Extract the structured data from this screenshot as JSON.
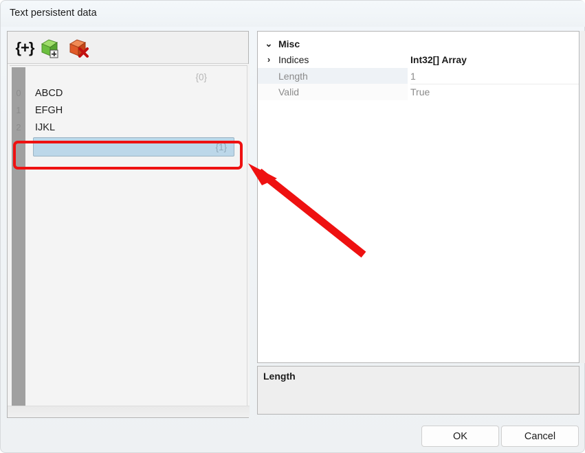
{
  "window": {
    "title": "Text persistent data"
  },
  "toolbar": {
    "items": [
      {
        "name": "braces-icon",
        "glyph": "{+}",
        "label": "{+}"
      },
      {
        "name": "add-item-icon",
        "label": "Add item"
      },
      {
        "name": "delete-item-icon",
        "label": "Delete item"
      }
    ]
  },
  "list": {
    "header_count": "{0}",
    "rows": [
      {
        "index": "0",
        "label": "ABCD"
      },
      {
        "index": "1",
        "label": "EFGH"
      },
      {
        "index": "2",
        "label": "IJKL"
      }
    ],
    "selected_row": {
      "index": "",
      "value": "",
      "count": "{1}"
    }
  },
  "properties": {
    "category": {
      "label": "Misc",
      "expander": "⌄"
    },
    "rows": [
      {
        "expander": "›",
        "name": "Indices",
        "value": "Int32[] Array"
      },
      {
        "expander": "",
        "name": "Length",
        "value": "1"
      },
      {
        "expander": "",
        "name": "Valid",
        "value": "True"
      }
    ]
  },
  "description": {
    "title": "Length"
  },
  "buttons": {
    "ok": "OK",
    "cancel": "Cancel"
  },
  "colors": {
    "annotation": "#ee1111",
    "selection": "#bcd7e9",
    "add_icon": "#6cbf3f",
    "delete_icon": "#e05a28"
  }
}
